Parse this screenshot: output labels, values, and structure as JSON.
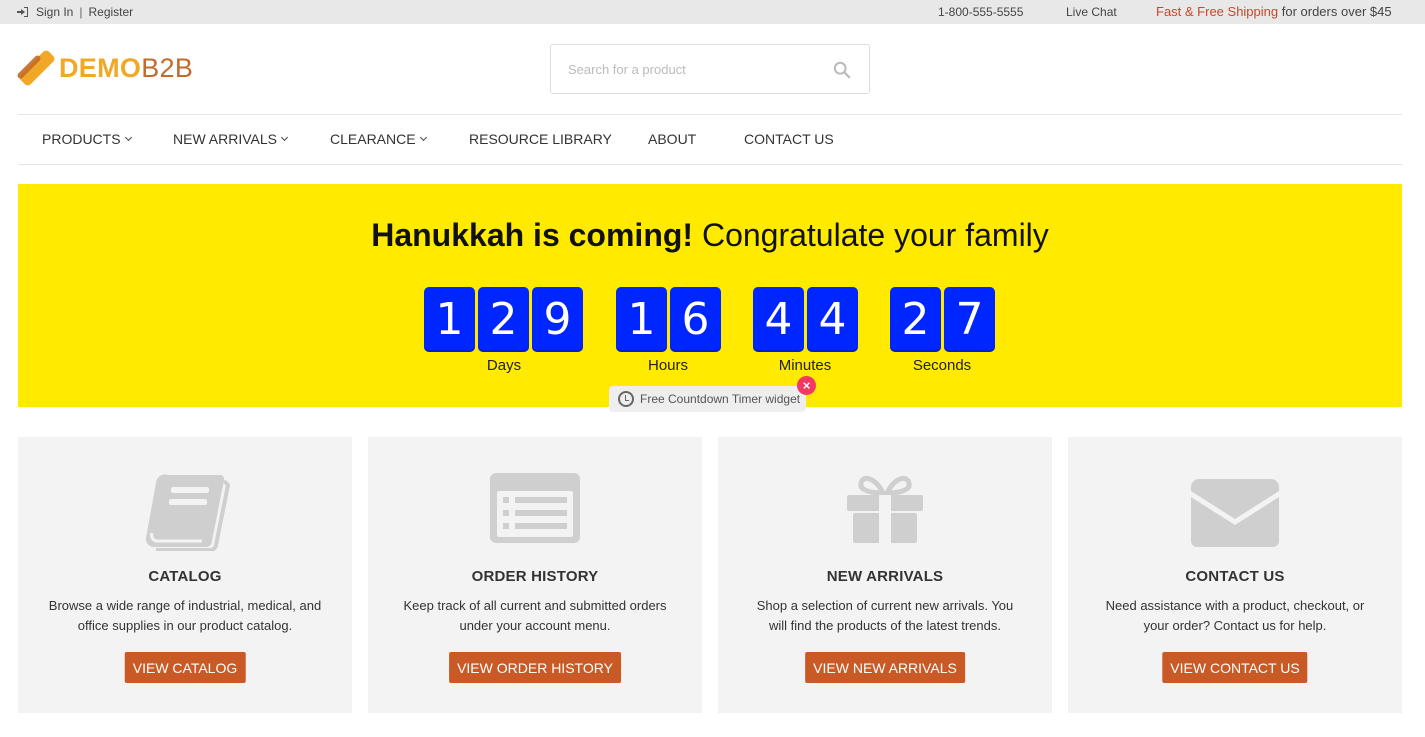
{
  "topbar": {
    "sign_in": "Sign In",
    "separator": "|",
    "register": "Register",
    "phone": "1-800-555-5555",
    "live_chat": "Live Chat",
    "shipping_accent": "Fast & Free Shipping",
    "shipping_rest": " for orders over $45"
  },
  "header": {
    "logo_demo": "DEMO",
    "logo_b2b": "B2B",
    "search_placeholder": "Search for a product",
    "search_value": ""
  },
  "nav": {
    "items": [
      {
        "label": "PRODUCTS",
        "dropdown": true
      },
      {
        "label": "NEW ARRIVALS",
        "dropdown": true
      },
      {
        "label": "CLEARANCE",
        "dropdown": true
      },
      {
        "label": "RESOURCE LIBRARY",
        "dropdown": false
      },
      {
        "label": "ABOUT",
        "dropdown": false
      },
      {
        "label": "CONTACT US",
        "dropdown": false
      }
    ]
  },
  "banner": {
    "title_bold": "Hanukkah is coming!",
    "title_rest": " Congratulate your family",
    "background": "#ffea00",
    "digit_color": "#0026ff",
    "countdown": {
      "days": [
        "1",
        "2",
        "9"
      ],
      "hours": [
        "1",
        "6"
      ],
      "minutes": [
        "4",
        "4"
      ],
      "seconds": [
        "2",
        "7"
      ]
    },
    "labels": {
      "days": "Days",
      "hours": "Hours",
      "minutes": "Minutes",
      "seconds": "Seconds"
    },
    "widget_badge": "Free Countdown Timer widget",
    "close_symbol": "×"
  },
  "cards": [
    {
      "icon": "book-icon",
      "title": "CATALOG",
      "desc": "Browse a wide range of industrial, medical, and office supplies in our product catalog.",
      "button": "VIEW CATALOG"
    },
    {
      "icon": "list-icon",
      "title": "ORDER HISTORY",
      "desc": "Keep track of all current and submitted orders under your account menu.",
      "button": "VIEW ORDER HISTORY"
    },
    {
      "icon": "gift-icon",
      "title": "NEW ARRIVALS",
      "desc": "Shop a selection of current new arrivals. You will find the products of the latest trends.",
      "button": "VIEW NEW ARRIVALS"
    },
    {
      "icon": "envelope-icon",
      "title": "CONTACT US",
      "desc": "Need assistance with a product, checkout, or your order? Contact us for help.",
      "button": "VIEW CONTACT US"
    }
  ],
  "colors": {
    "accent": "#c95a26",
    "shipping_accent": "#c9482a",
    "logo_orange": "#f0a826",
    "logo_brown": "#c46a2a"
  }
}
